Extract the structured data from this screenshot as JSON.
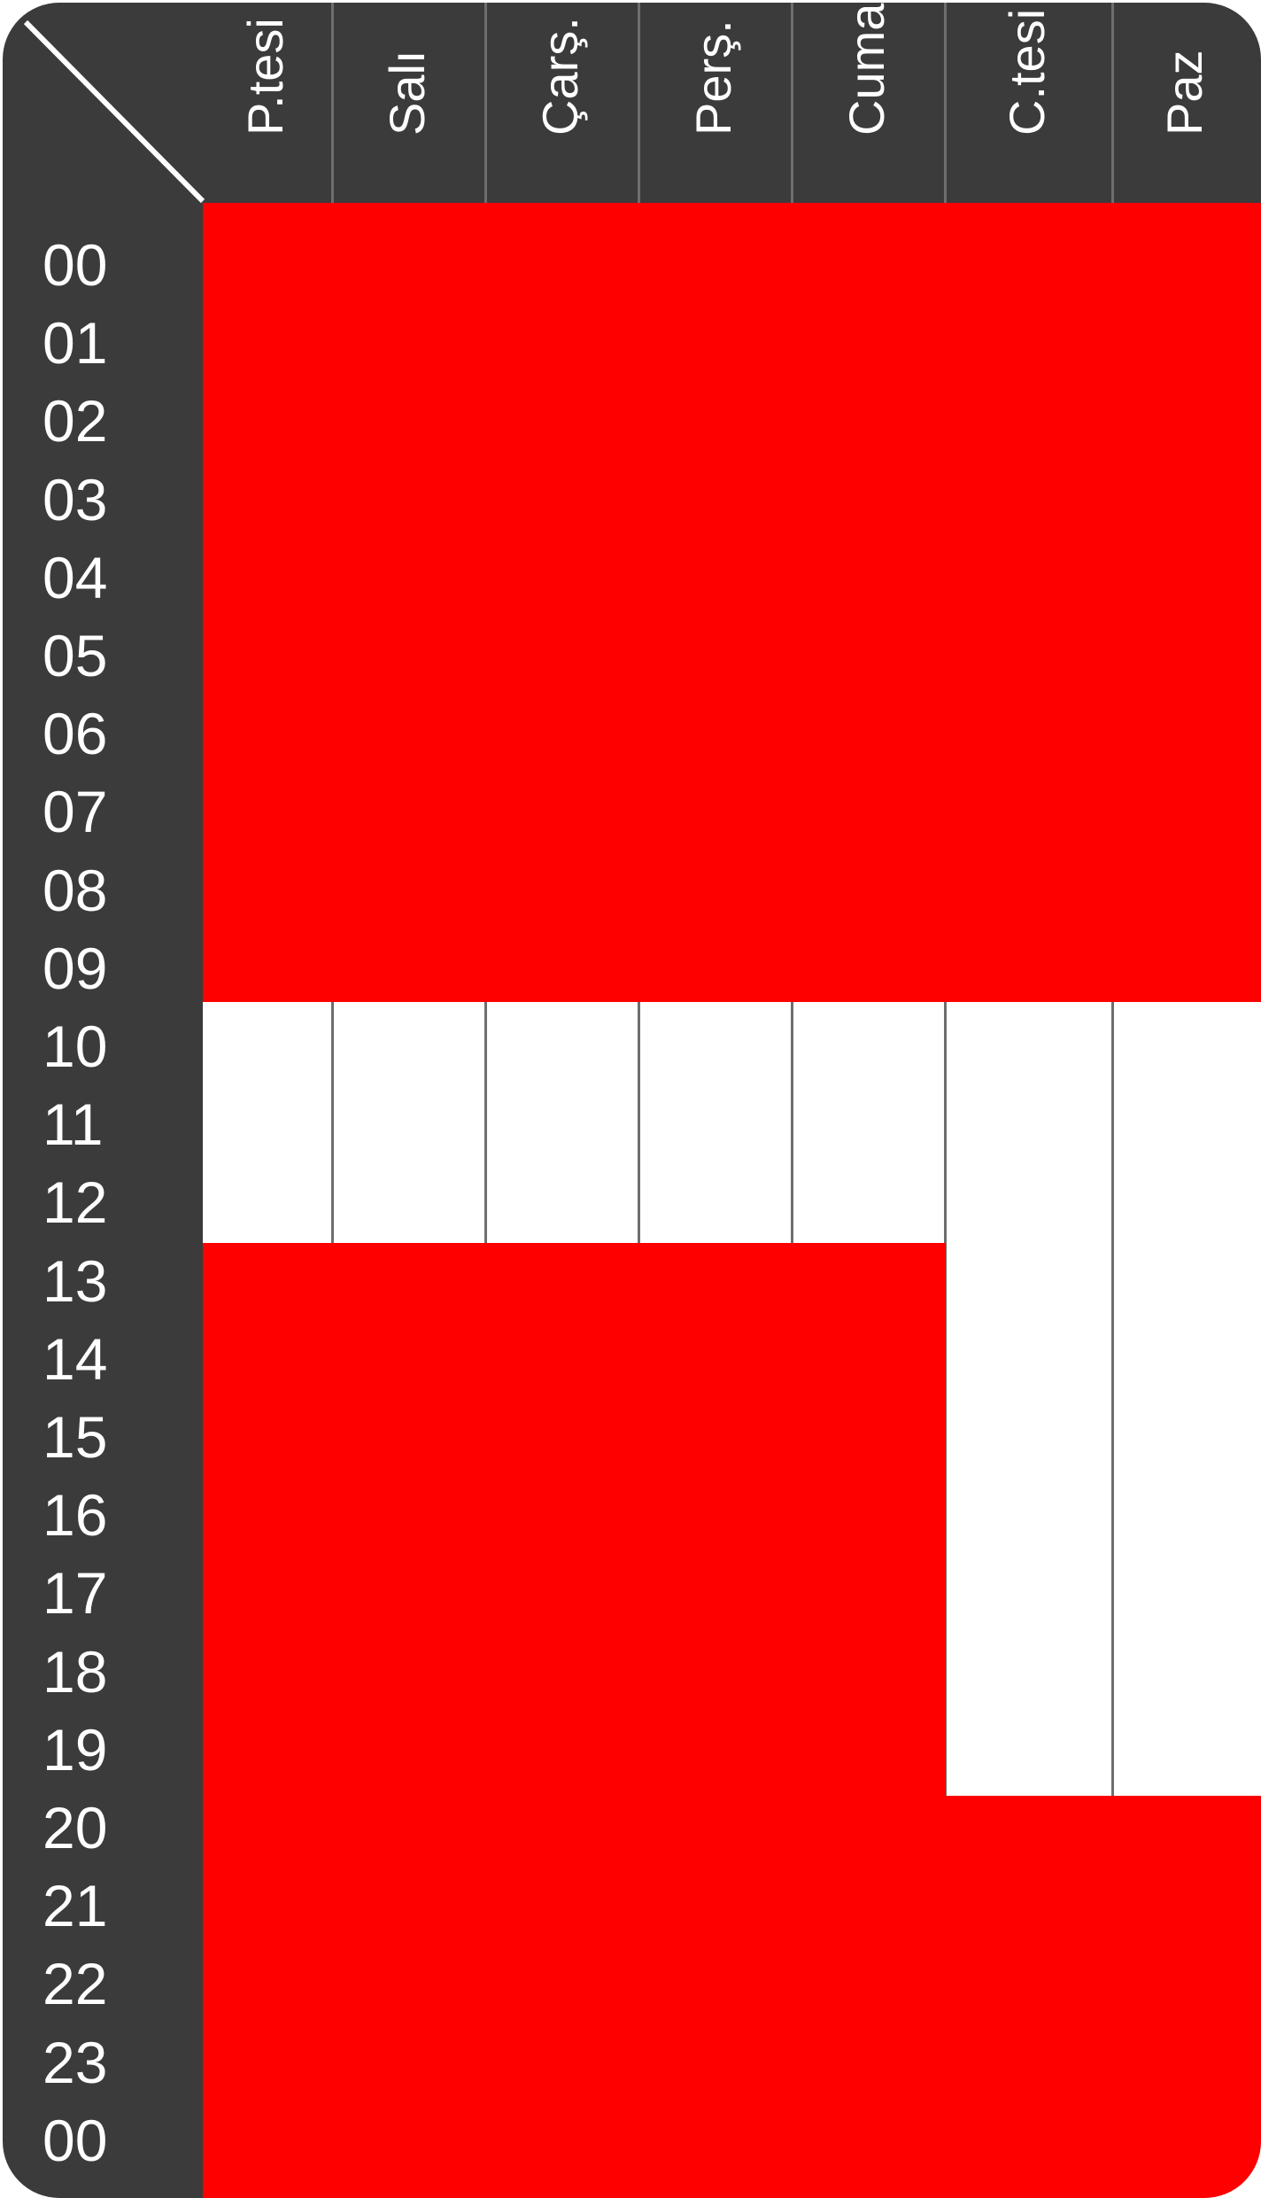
{
  "schedule": {
    "days": [
      "P.tesi",
      "Salı",
      "Çarş.",
      "Perş.",
      "Cuma",
      "C.tesi",
      "Paz"
    ],
    "hours": [
      "00",
      "01",
      "02",
      "03",
      "04",
      "05",
      "06",
      "07",
      "08",
      "09",
      "10",
      "11",
      "12",
      "13",
      "14",
      "15",
      "16",
      "17",
      "18",
      "19",
      "20",
      "21",
      "22",
      "23",
      "00"
    ],
    "colors": {
      "closed": "#ff0000",
      "open": "#ffffff",
      "frame": "#3b3b3b",
      "grid_line": "#6e6e6e"
    },
    "closed_ranges": {
      "P.tesi": [
        [
          0,
          10
        ],
        [
          13,
          24
        ]
      ],
      "Salı": [
        [
          0,
          10
        ],
        [
          13,
          24
        ]
      ],
      "Çarş.": [
        [
          0,
          10
        ],
        [
          13,
          24
        ]
      ],
      "Perş.": [
        [
          0,
          10
        ],
        [
          13,
          24
        ]
      ],
      "Cuma": [
        [
          0,
          10
        ],
        [
          13,
          24
        ]
      ],
      "C.tesi": [
        [
          0,
          10
        ],
        [
          20,
          24
        ]
      ],
      "Paz": [
        [
          0,
          10
        ],
        [
          20,
          24
        ]
      ]
    }
  }
}
